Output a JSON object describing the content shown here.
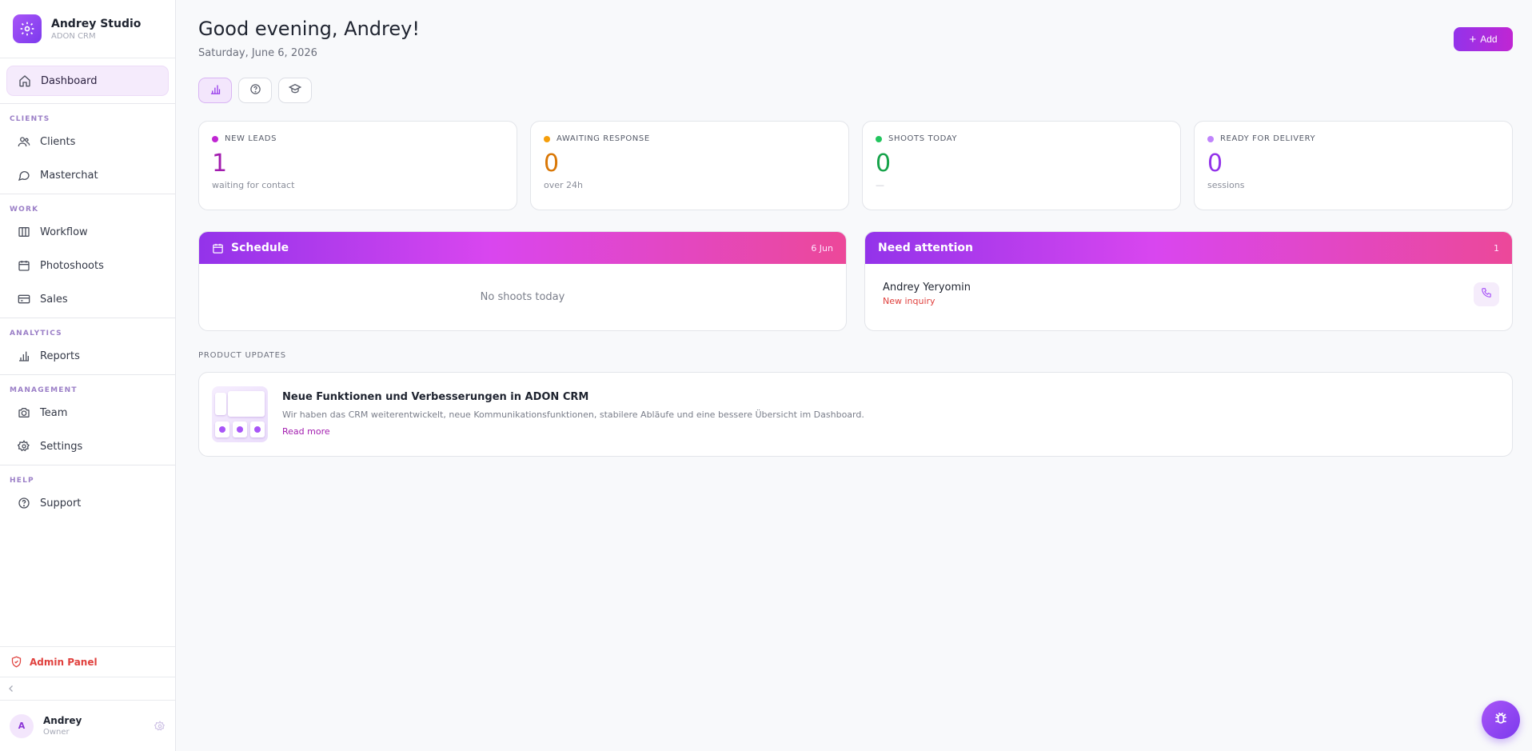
{
  "brand": {
    "name": "Andrey Studio",
    "subtitle": "ADON CRM",
    "icon": "gear-icon"
  },
  "nav": {
    "dashboard": "Dashboard",
    "sections": {
      "clients": "CLIENTS",
      "work": "WORK",
      "analytics": "ANALYTICS",
      "management": "MANAGEMENT",
      "help": "HELP"
    },
    "items": {
      "clients": "Clients",
      "masterchat": "Masterchat",
      "workflow": "Workflow",
      "photoshoots": "Photoshoots",
      "sales": "Sales",
      "reports": "Reports",
      "team": "Team",
      "settings": "Settings",
      "support": "Support"
    }
  },
  "admin_panel": "Admin Panel",
  "user": {
    "initial": "A",
    "name": "Andrey",
    "role": "Owner"
  },
  "header": {
    "greeting": "Good evening, Andrey!",
    "date": "Saturday, June 6, 2026",
    "add_label": "Add"
  },
  "stats": [
    {
      "label": "NEW LEADS",
      "value": "1",
      "sub": "waiting for contact",
      "color": "#a21caf",
      "dot": "#c026d3"
    },
    {
      "label": "AWAITING RESPONSE",
      "value": "0",
      "sub": "over 24h",
      "color": "#d97706",
      "dot": "#f59e0b"
    },
    {
      "label": "SHOOTS TODAY",
      "value": "0",
      "sub": "—",
      "color": "#16a34a",
      "dot": "#22c55e"
    },
    {
      "label": "READY FOR DELIVERY",
      "value": "0",
      "sub": "sessions",
      "color": "#9333ea",
      "dot": "#c084fc"
    }
  ],
  "schedule": {
    "title": "Schedule",
    "date": "6 Jun",
    "empty": "No shoots today"
  },
  "attention": {
    "title": "Need attention",
    "count": "1",
    "items": [
      {
        "name": "Andrey Yeryomin",
        "status": "New inquiry"
      }
    ]
  },
  "product_updates": {
    "label": "PRODUCT UPDATES",
    "title": "Neue Funktionen und Verbesserungen in ADON CRM",
    "text": "Wir haben das CRM weiterentwickelt, neue Kommunikationsfunktionen, stabilere Abläufe und eine bessere Übersicht im Dashboard.",
    "link": "Read more"
  },
  "colors": {
    "accent": "#9333ea",
    "accent2": "#d946ef",
    "danger": "#e0413e"
  }
}
